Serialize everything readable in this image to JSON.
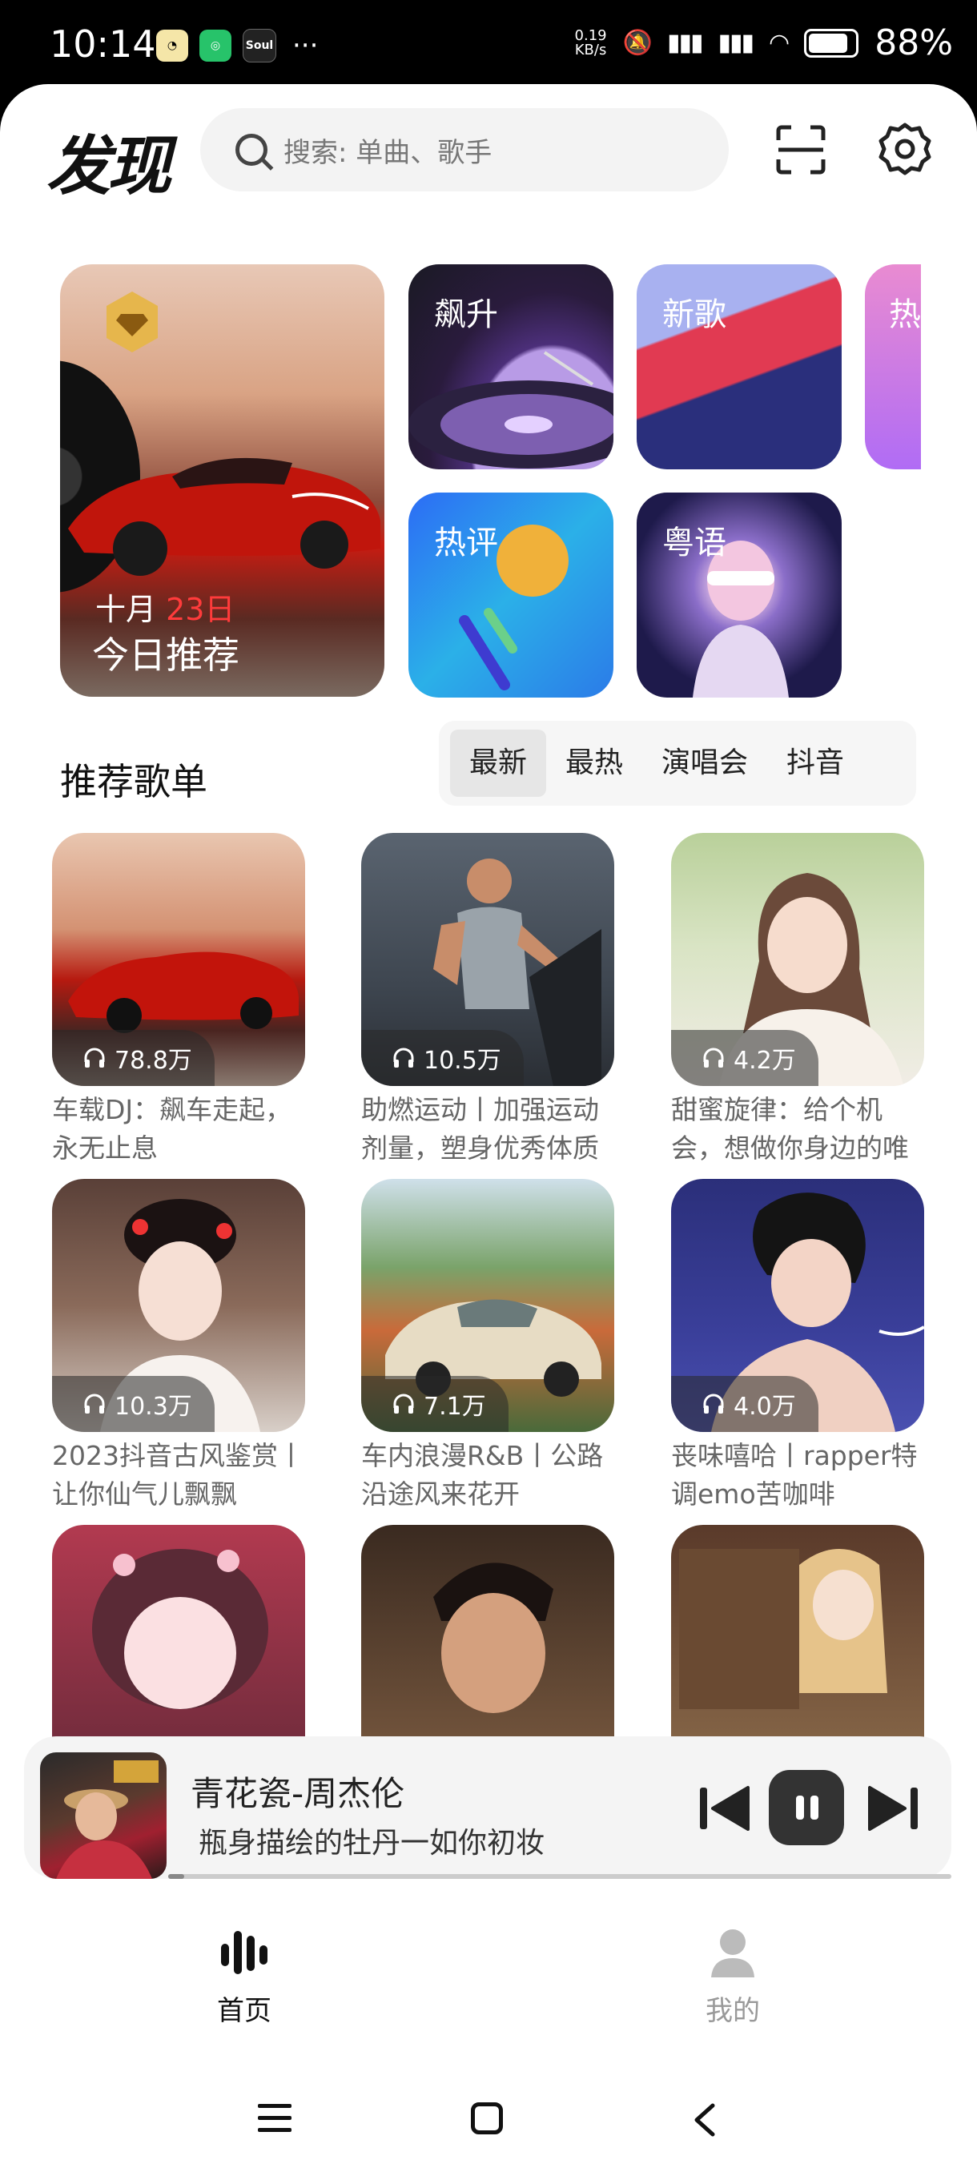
{
  "status_bar": {
    "time": "10:14",
    "speed_value": "0.19",
    "speed_unit": "KB/s",
    "battery": "88%",
    "app_icons": [
      "weather-app",
      "green-app",
      "Soul"
    ],
    "more": "···"
  },
  "header": {
    "title": "发现",
    "search_placeholder": "搜索: 单曲、歌手"
  },
  "featured": {
    "hero": {
      "month": "十月",
      "day": "23日",
      "title": "今日推荐"
    },
    "tiles": [
      {
        "label": "飙升"
      },
      {
        "label": "新歌"
      },
      {
        "label": "热"
      },
      {
        "label": "热评"
      },
      {
        "label": "粤语"
      }
    ]
  },
  "playlists": {
    "section_title": "推荐歌单",
    "tabs": [
      "最新",
      "最热",
      "演唱会",
      "抖音"
    ],
    "active_tab": "最新",
    "items": [
      {
        "plays": "78.8万",
        "title": "车载DJ：飙车走起，永无止息"
      },
      {
        "plays": "10.5万",
        "title": "助燃运动丨加强运动剂量，塑身优秀体质"
      },
      {
        "plays": "4.2万",
        "title": "甜蜜旋律：给个机会，想做你身边的唯"
      },
      {
        "plays": "10.3万",
        "title": "2023抖音古风鉴赏丨让你仙气儿飘飘"
      },
      {
        "plays": "7.1万",
        "title": "车内浪漫R&B丨公路沿途风来花开"
      },
      {
        "plays": "4.0万",
        "title": "丧味嘻哈丨rapper特调emo苦咖啡"
      },
      {
        "plays": "",
        "title": ""
      },
      {
        "plays": "",
        "title": ""
      },
      {
        "plays": "",
        "title": ""
      }
    ]
  },
  "player": {
    "song": "青花瓷-周杰伦",
    "lyric": "瓶身描绘的牡丹一如你初妆",
    "progress": 0.02
  },
  "bottom_nav": {
    "home_label": "首页",
    "me_label": "我的"
  }
}
